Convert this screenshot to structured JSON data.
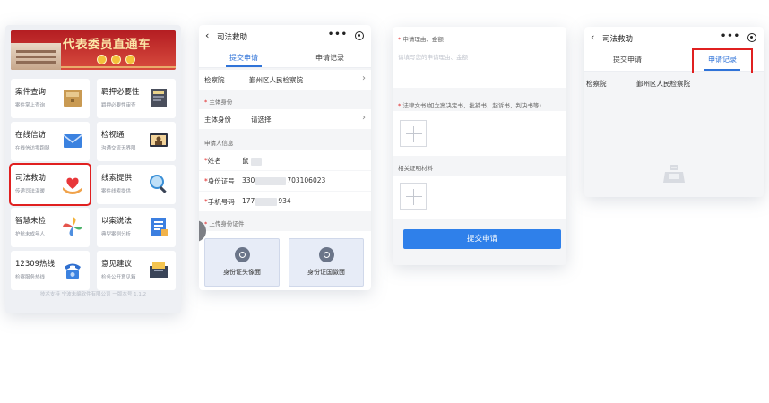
{
  "screen1": {
    "banner_title": "代表委员直通车",
    "tiles": [
      {
        "title": "案件查询",
        "sub": "案件掌上查询"
      },
      {
        "title": "羁押必要性",
        "sub": "羁押必要性审查"
      },
      {
        "title": "在线信访",
        "sub": "在线信访零跑腿"
      },
      {
        "title": "检视通",
        "sub": "沟通交流无界限"
      },
      {
        "title": "司法救助",
        "sub": "传递司法温暖"
      },
      {
        "title": "线索提供",
        "sub": "案件线索提供"
      },
      {
        "title": "智慧未检",
        "sub": "护航未成年人"
      },
      {
        "title": "以案说法",
        "sub": "典型案例分析"
      },
      {
        "title": "12309热线",
        "sub": "检察服务热线"
      },
      {
        "title": "意见建议",
        "sub": "检务公开意见箱"
      }
    ],
    "footer": "技术支持  宁波未编软件有限公司 一版本号 1.1.2"
  },
  "screen2": {
    "back": "‹",
    "title": "司法救助",
    "more": "•••",
    "tab_submit": "提交申请",
    "tab_records": "申请记录",
    "procuratorate_label": "检察院",
    "procuratorate_value": "鄞州区人民检察院",
    "subject_section": "主体身份",
    "subject_label": "主体身份",
    "subject_value": "请选择",
    "applicant_section": "申请人信息",
    "name_label": "姓名",
    "name_value": "鼠",
    "id_label": "身份证号",
    "id_prefix": "330",
    "id_suffix": "703106023",
    "phone_label": "手机号码",
    "phone_prefix": "177",
    "phone_suffix": "934",
    "upload_section": "上传身份证件",
    "id_front": "身份证头像面",
    "id_back": "身份证国徽面",
    "required_mark": "*"
  },
  "screen3": {
    "reason_label": "申请理由、金额",
    "reason_placeholder": "请填写您的申请理由、金额",
    "docs_label": "法律文书(如立案决定书，批捕书，起诉书，判决书等)",
    "proof_label": "相关证明材料",
    "submit_label": "提交申请",
    "required_mark": "*"
  },
  "screen4": {
    "back": "‹",
    "title": "司法救助",
    "more": "•••",
    "tab_submit": "提交申请",
    "tab_records": "申请记录",
    "procuratorate_label": "检察院",
    "procuratorate_value": "鄞州区人民检察院"
  }
}
